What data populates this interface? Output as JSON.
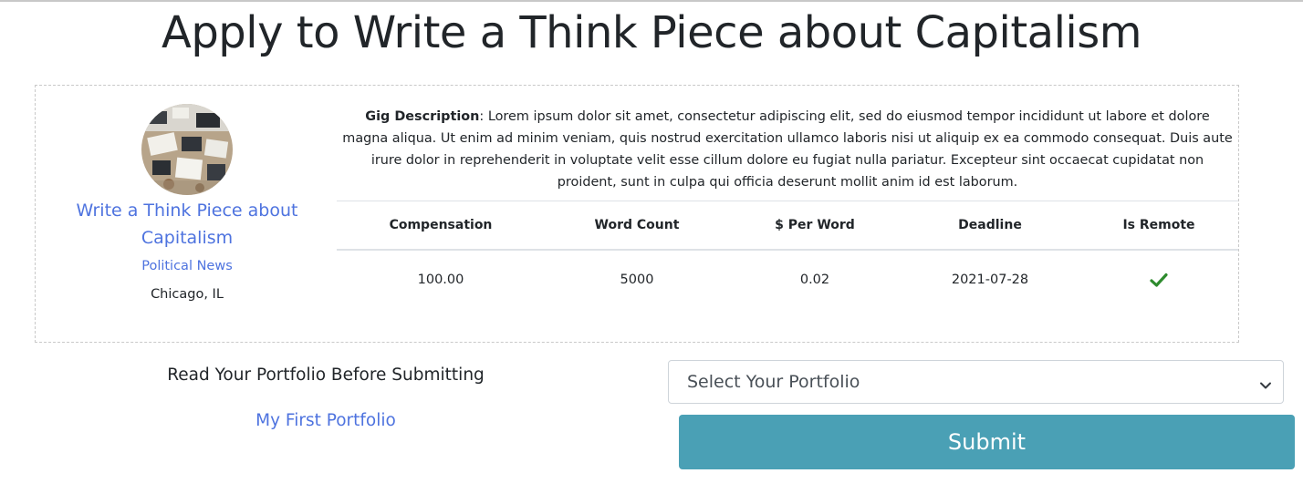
{
  "page": {
    "title": "Apply to Write a Think Piece about Capitalism"
  },
  "gig": {
    "title": "Write a Think Piece about Capitalism",
    "category": "Political News",
    "location": "Chicago, IL",
    "description_label": "Gig Description",
    "description_text": ": Lorem ipsum dolor sit amet, consectetur adipiscing elit, sed do eiusmod tempor incididunt ut labore et dolore magna aliqua. Ut enim ad minim veniam, quis nostrud exercitation ullamco laboris nisi ut aliquip ex ea commodo consequat. Duis aute irure dolor in reprehenderit in voluptate velit esse cillum dolore eu fugiat nulla pariatur. Excepteur sint occaecat cupidatat non proident, sunt in culpa qui officia deserunt mollit anim id est laborum.",
    "table": {
      "headers": [
        "Compensation",
        "Word Count",
        "$ Per Word",
        "Deadline",
        "Is Remote"
      ],
      "row": {
        "compensation": "100.00",
        "word_count": "5000",
        "per_word": "0.02",
        "deadline": "2021-07-28",
        "is_remote_icon": "check-icon"
      }
    }
  },
  "portfolio": {
    "hint": "Read Your Portfolio Before Submitting",
    "link_label": "My First Portfolio",
    "select_value": "Select Your Portfolio"
  },
  "actions": {
    "submit_label": "Submit"
  },
  "colors": {
    "link": "#4e73df",
    "submit": "#4aa0b5",
    "check": "#2e8b2e"
  }
}
